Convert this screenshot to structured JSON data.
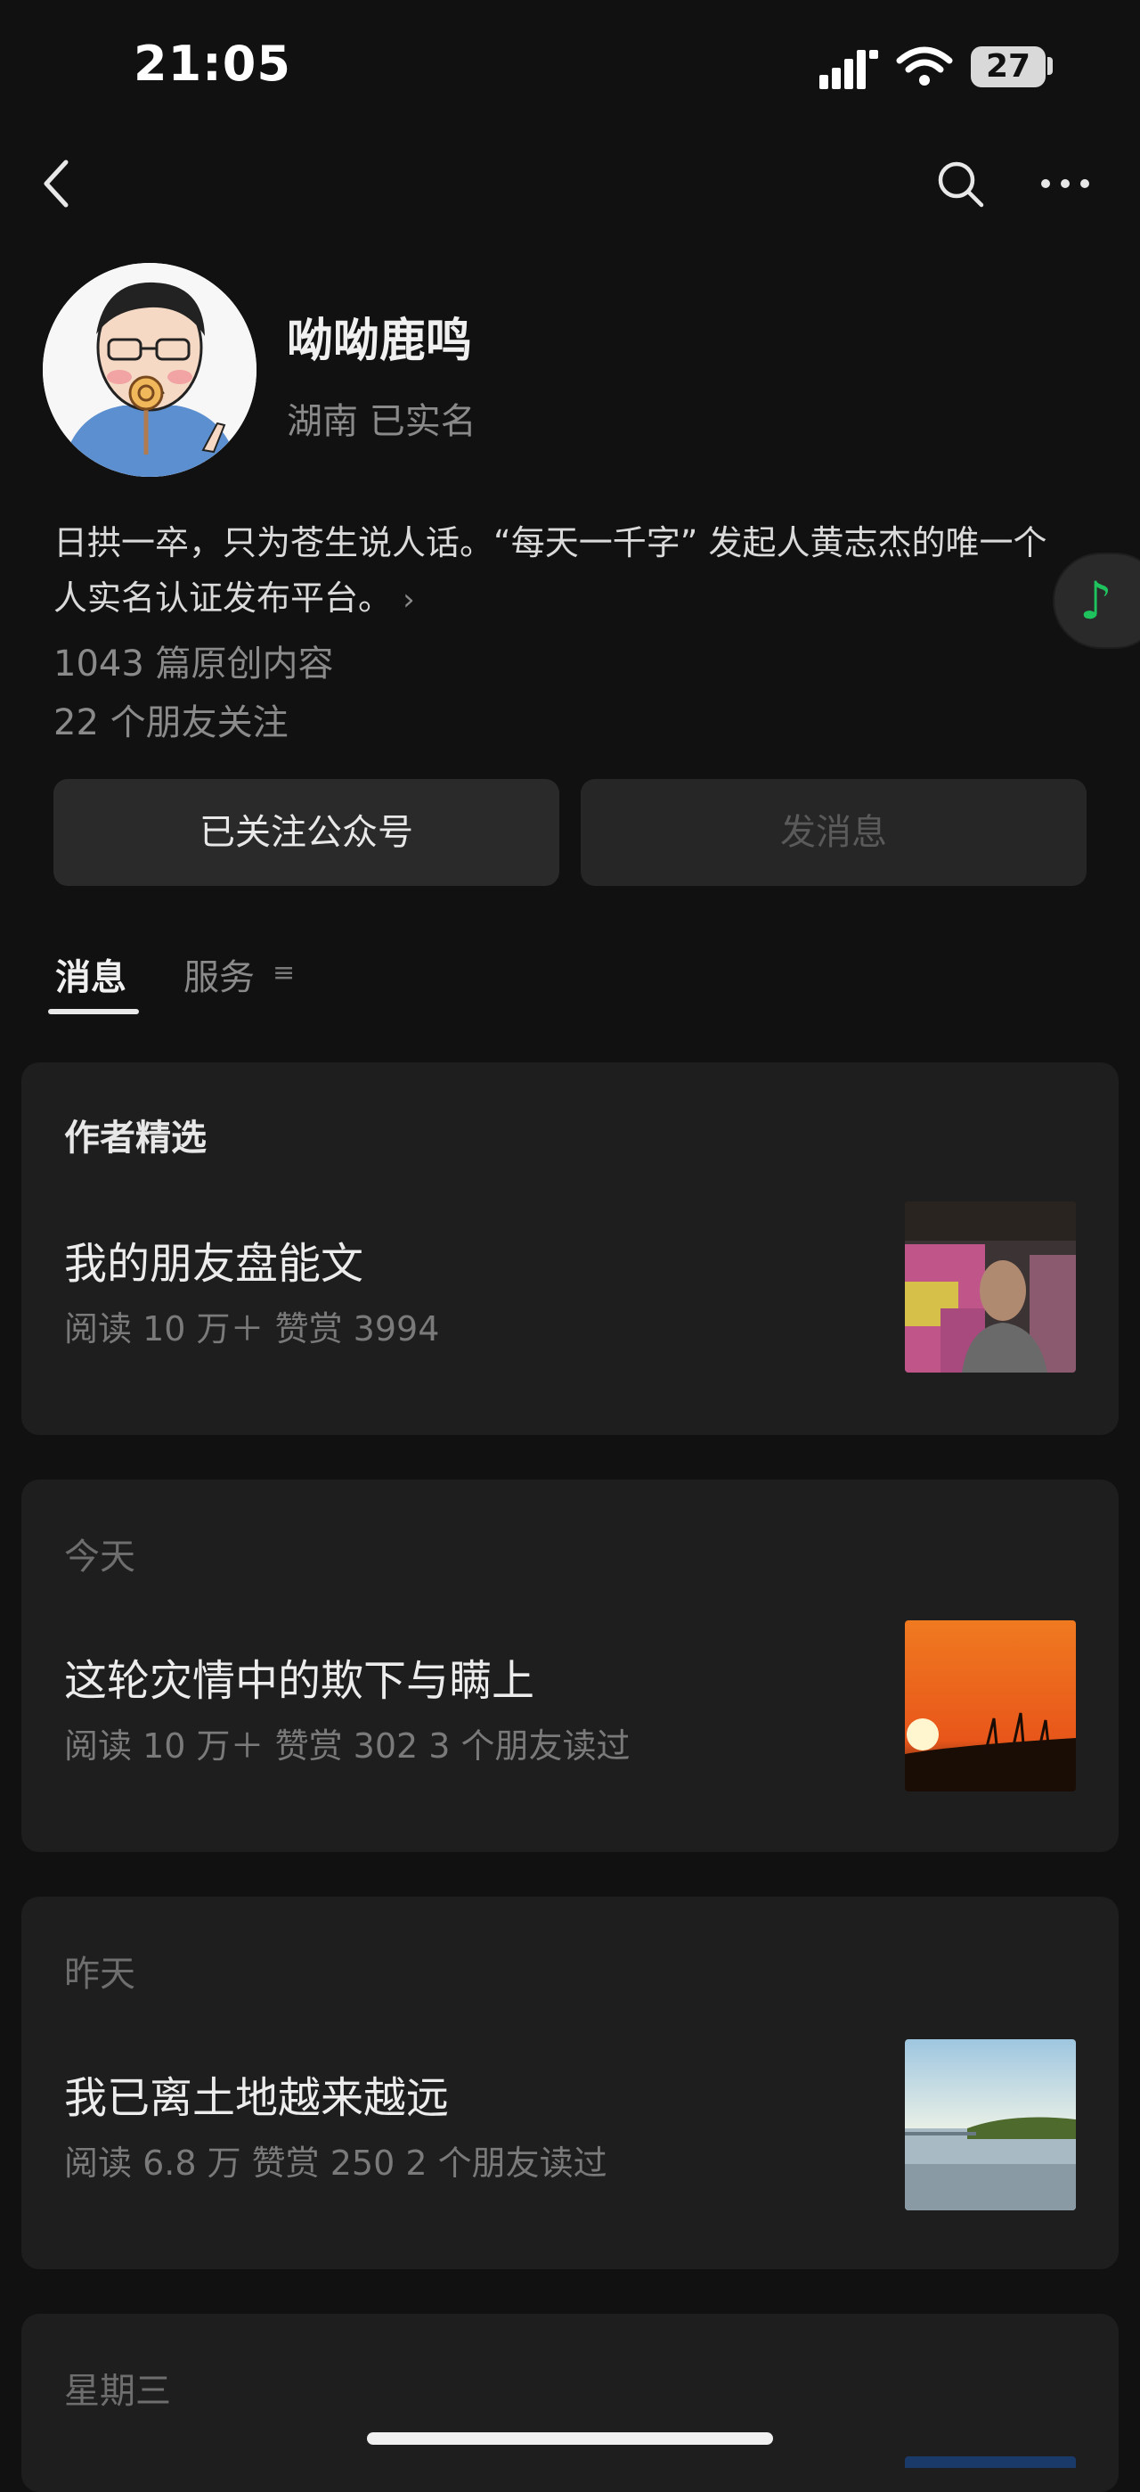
{
  "status_bar": {
    "time": "21:05",
    "battery": "27"
  },
  "nav": {
    "back_icon": "chevron-left-icon",
    "search_icon": "search-icon",
    "more_icon": "more-dots-icon"
  },
  "profile": {
    "name": "呦呦鹿鸣",
    "location": "湖南 已实名",
    "intro": "日拱一卒，只为苍生说人话。“每天一千字” 发起人黄志杰的唯一个人实名认证发布平台。",
    "intro_more": "›",
    "original_count": "1043 篇原创内容",
    "friends_follow": "22 个朋友关注"
  },
  "buttons": {
    "follow": "已关注公众号",
    "message": "发消息"
  },
  "tabs": {
    "messages": "消息",
    "services": "服务",
    "services_icon": "≡"
  },
  "featured": {
    "label": "作者精选",
    "title": "我的朋友盘能文",
    "meta": "阅读 10 万＋  赞赏 3994"
  },
  "articles": [
    {
      "day": "今天",
      "title": "这轮灾情中的欺下与瞒上",
      "meta": "阅读 10 万＋  赞赏 302   3 个朋友读过"
    },
    {
      "day": "昨天",
      "title": "我已离土地越来越远",
      "meta": "阅读 6.8 万   赞赏 250   2 个朋友读过"
    },
    {
      "day": "星期三"
    }
  ],
  "colors": {
    "background": "#111111",
    "card": "#1e1e1e",
    "music_green": "#1fc35d"
  }
}
